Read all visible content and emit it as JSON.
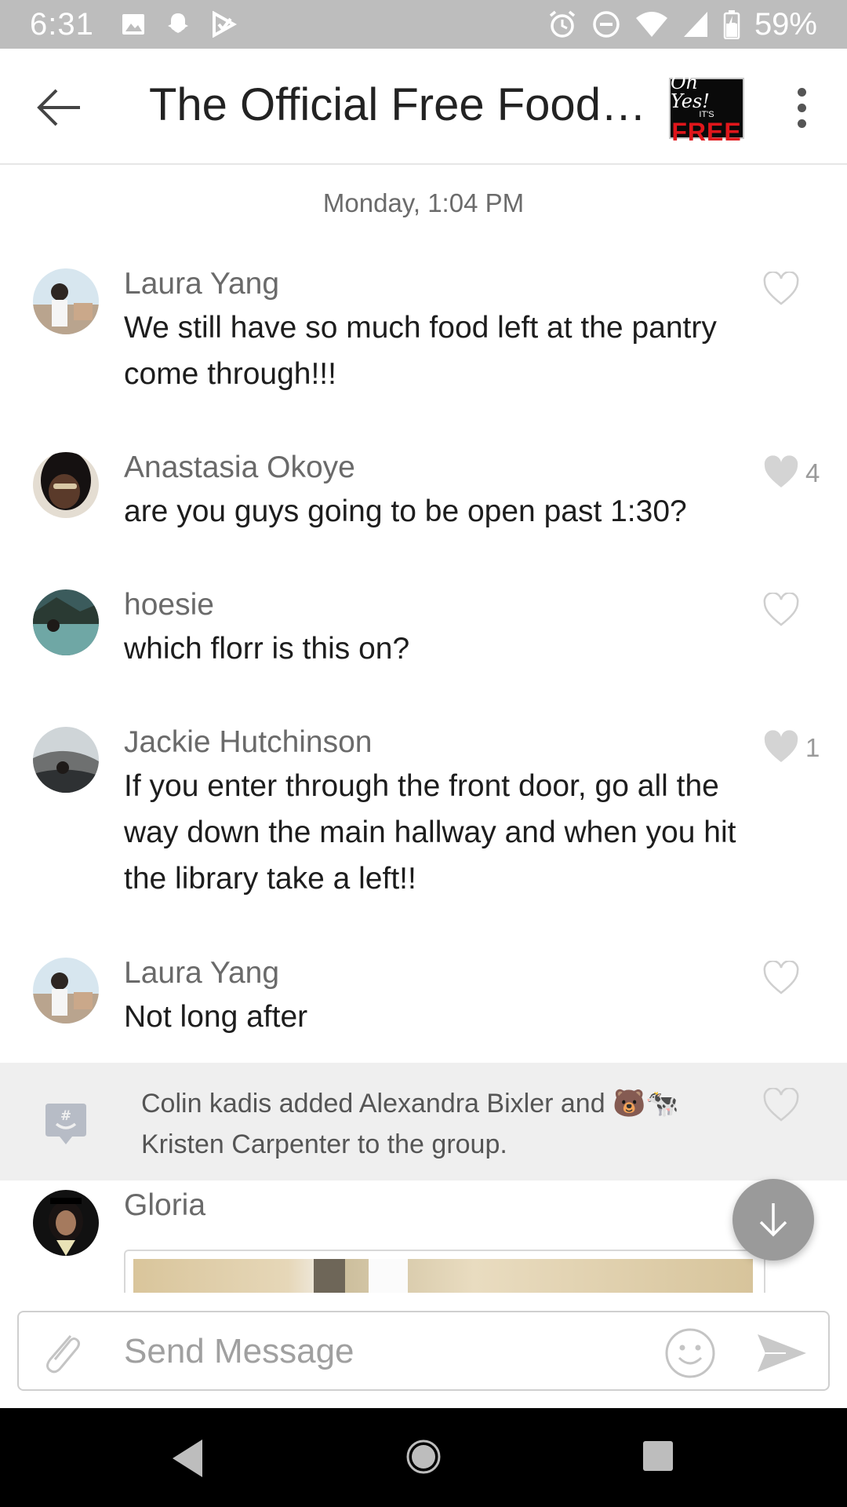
{
  "status_bar": {
    "time": "6:31",
    "battery": "59%",
    "icons_left": [
      "image-icon",
      "snapchat-icon",
      "play-store-icon"
    ],
    "icons_right": [
      "alarm-icon",
      "dnd-icon",
      "wifi-icon",
      "signal-icon",
      "battery-icon"
    ]
  },
  "header": {
    "title": "The Official Free Food …",
    "logo": {
      "top": "Oh Yes!",
      "its": "IT'S",
      "free": "FREE"
    }
  },
  "chat": {
    "date_separator": "Monday, 1:04 PM",
    "messages": [
      {
        "author": "Laura Yang",
        "text": "We still have so much food left at the pantry come through!!!",
        "likes": "",
        "liked": false
      },
      {
        "author": "Anastasia Okoye",
        "text": "are you guys going to be open past 1:30?",
        "likes": "4",
        "liked": true
      },
      {
        "author": "hoesie",
        "text": "which florr is this on?",
        "likes": "",
        "liked": false
      },
      {
        "author": "Jackie Hutchinson",
        "text": "If you enter through the front door, go all the way down the main hallway and when you hit the library take a left!!",
        "likes": "1",
        "liked": true
      },
      {
        "author": "Laura Yang",
        "text": "Not long after",
        "likes": "",
        "liked": false
      }
    ],
    "system_message": "Colin kadis added Alexandra Bixler and 🐻🐄 Kristen Carpenter to the group.",
    "last_author": "Gloria"
  },
  "composer": {
    "placeholder": "Send Message"
  },
  "colors": {
    "status_bar": "#bdbdbd",
    "liked_heart": "#d4d4d4",
    "fab": "#9a9a9a",
    "logo_red": "#e0161b"
  }
}
